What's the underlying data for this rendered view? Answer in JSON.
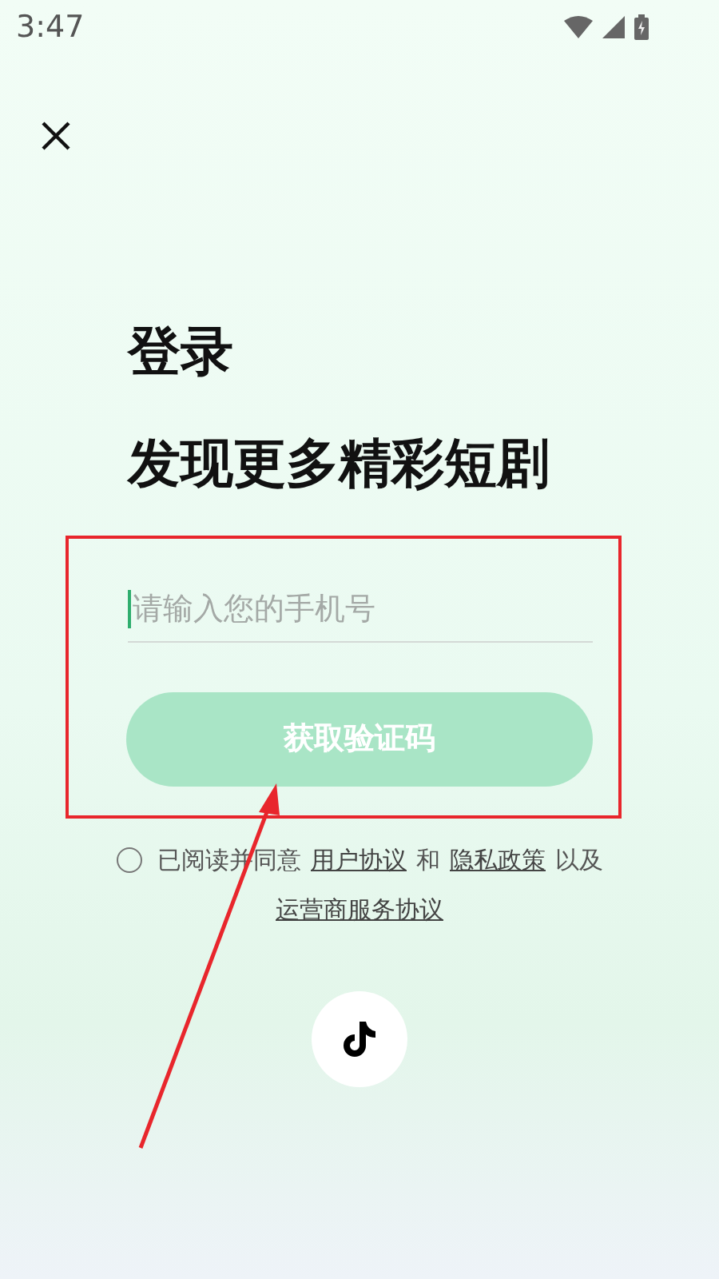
{
  "status_bar": {
    "time": "3:47"
  },
  "title": "登录",
  "subtitle": "发现更多精彩短剧",
  "phone_field": {
    "placeholder": "请输入您的手机号"
  },
  "submit_button": {
    "label": "获取验证码",
    "disabled": true
  },
  "agreement": {
    "checked": false,
    "parts": [
      {
        "kind": "text",
        "text": "已阅读并同意"
      },
      {
        "kind": "link",
        "text": "用户协议"
      },
      {
        "kind": "text",
        "text": "和"
      },
      {
        "kind": "link",
        "text": "隐私政策"
      },
      {
        "kind": "text",
        "text": "以及"
      },
      {
        "kind": "link",
        "text": "运营商服务协议"
      }
    ]
  }
}
